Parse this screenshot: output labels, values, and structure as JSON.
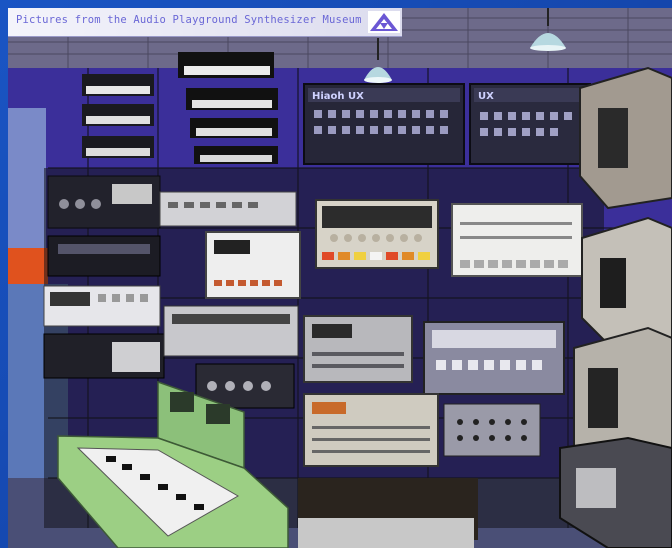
{
  "caption": {
    "text": "Pictures from the Audio Playground Synthesizer Museum"
  },
  "photo": {
    "subject": "synthesizer-museum-racks",
    "colors": {
      "wall": "#3b2f9a",
      "rack": "#1c1c24",
      "keyboard_green": "#9ccf84",
      "panel_light": "#d8d8d4",
      "frame_blue": "#1648b0"
    }
  },
  "labels": {
    "center_synth_top": "Hiaoh UX",
    "center_synth_right": "UX"
  }
}
